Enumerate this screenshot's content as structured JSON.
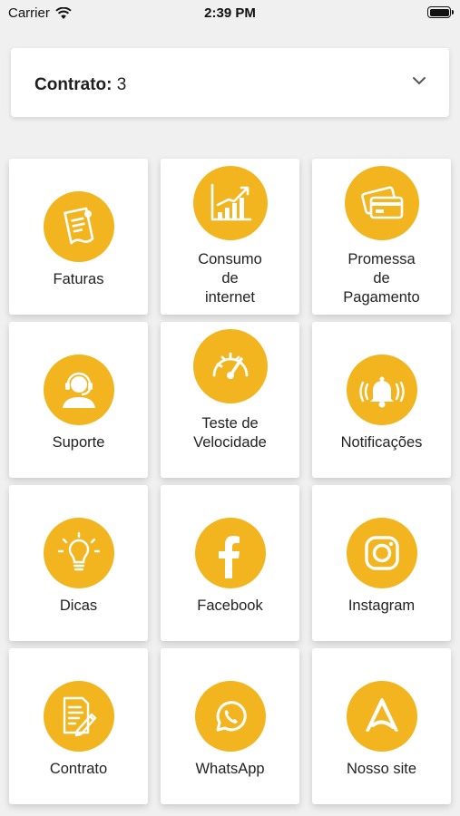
{
  "status_bar": {
    "carrier": "Carrier",
    "time": "2:39 PM"
  },
  "contract": {
    "label": "Contrato:",
    "value": "3"
  },
  "accent_color": "#f2b51f",
  "tiles": [
    {
      "label": "Faturas",
      "icon": "invoice-icon"
    },
    {
      "label": "Consumo\nde\ninternet",
      "icon": "chart-growth-icon"
    },
    {
      "label": "Promessa\nde\nPagamento",
      "icon": "credit-card-icon"
    },
    {
      "label": "Suporte",
      "icon": "support-agent-icon"
    },
    {
      "label": "Teste de\nVelocidade",
      "icon": "speedometer-icon"
    },
    {
      "label": "Notificações",
      "icon": "bell-icon"
    },
    {
      "label": "Dicas",
      "icon": "lightbulb-icon"
    },
    {
      "label": "Facebook",
      "icon": "facebook-icon"
    },
    {
      "label": "Instagram",
      "icon": "instagram-icon"
    },
    {
      "label": "Contrato",
      "icon": "contract-document-icon"
    },
    {
      "label": "WhatsApp",
      "icon": "whatsapp-icon"
    },
    {
      "label": "Nosso site",
      "icon": "website-logo-icon"
    }
  ]
}
